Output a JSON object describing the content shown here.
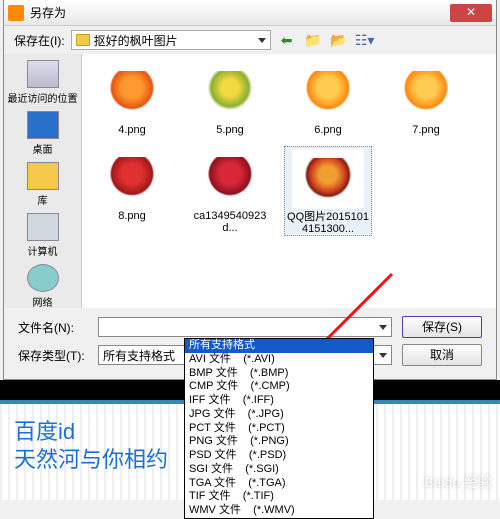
{
  "titlebar": {
    "title": "另存为"
  },
  "toolbar": {
    "save_in_label": "保存在(I):",
    "folder_name": "抠好的枫叶图片"
  },
  "sidebar": {
    "recent": "最近访问的位置",
    "desktop": "桌面",
    "library": "库",
    "computer": "计算机",
    "network": "网络"
  },
  "files": [
    {
      "name": "4.png",
      "leaf": "orange"
    },
    {
      "name": "5.png",
      "leaf": "green"
    },
    {
      "name": "6.png",
      "leaf": "amber"
    },
    {
      "name": "7.png",
      "leaf": "amber"
    },
    {
      "name": "8.png",
      "leaf": "red"
    },
    {
      "name": "ca1349540923d...",
      "leaf": "crimson"
    },
    {
      "name": "QQ图片20151014151300...",
      "leaf": "mixed",
      "selected": true
    }
  ],
  "bottom": {
    "filename_label": "文件名(N):",
    "filename_value": "",
    "filetype_label": "保存类型(T):",
    "filetype_value": "所有支持格式",
    "save_button": "保存(S)",
    "cancel_button": "取消"
  },
  "dropdown": {
    "highlighted": "所有支持格式",
    "options": [
      "AVI 文件    (*.AVI)",
      "BMP 文件    (*.BMP)",
      "CMP 文件    (*.CMP)",
      "IFF 文件    (*.IFF)",
      "JPG 文件    (*.JPG)",
      "PCT 文件    (*.PCT)",
      "PNG 文件    (*.PNG)",
      "PSD 文件    (*.PSD)",
      "SGI 文件    (*.SGI)",
      "TGA 文件    (*.TGA)",
      "TIF 文件    (*.TIF)",
      "WMV 文件    (*.WMV)"
    ]
  },
  "watermark": {
    "line1": "百度id",
    "line2": "天然河与你相约"
  },
  "footer_brand": "Baidu 经验"
}
